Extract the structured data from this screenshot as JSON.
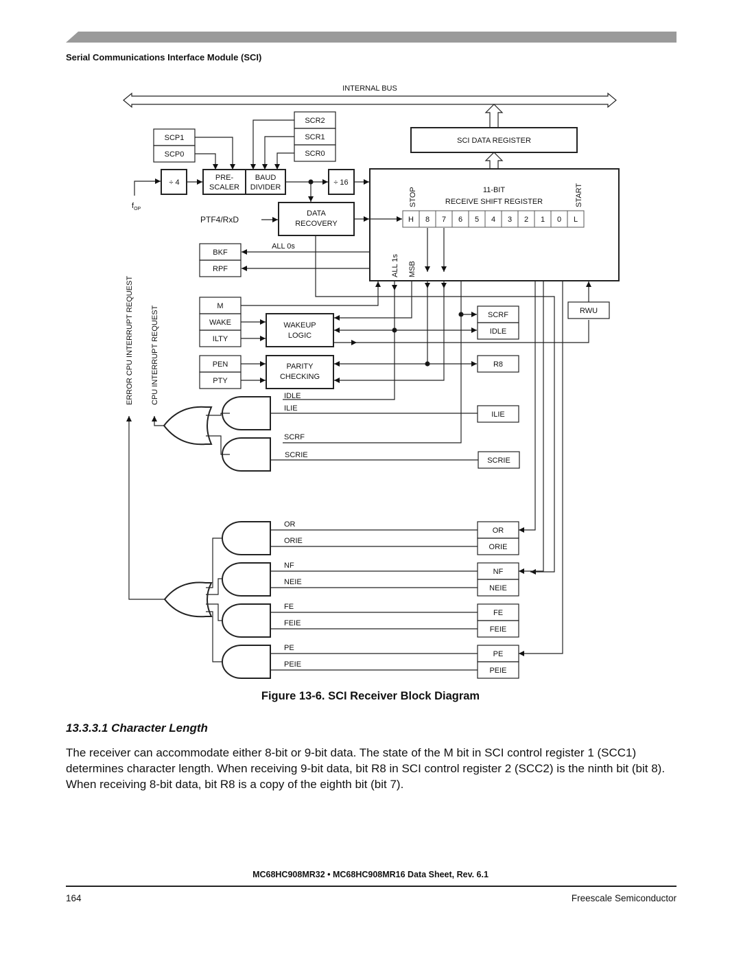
{
  "page": {
    "section_title": "Serial Communications Interface Module (SCI)",
    "figure_caption": "Figure 13-6. SCI Receiver Block Diagram",
    "subheading": "13.3.3.1  Character Length",
    "body": "The receiver can accommodate either 8-bit or 9-bit data. The state of the M bit in SCI control register 1 (SCC1) determines character length. When receiving 9-bit data, bit R8 in SCI control register 2 (SCC2) is the ninth bit (bit 8). When receiving 8-bit data, bit R8 is a copy of the eighth bit (bit 7).",
    "footer_title": "MC68HC908MR32 • MC68HC908MR16 Data Sheet, Rev. 6.1",
    "page_number": "164",
    "company": "Freescale Semiconductor",
    "header_bar_color": "#9a9a9a"
  },
  "diagram": {
    "internal_bus": "INTERNAL BUS",
    "sci_data_register": "SCI DATA REGISTER",
    "scp": [
      "SCP1",
      "SCP0"
    ],
    "scr": [
      "SCR2",
      "SCR1",
      "SCR0"
    ],
    "div4": "÷ 4",
    "div16": "÷ 16",
    "prescaler": [
      "PRE-",
      "SCALER"
    ],
    "baud_divider": [
      "BAUD",
      "DIVIDER"
    ],
    "fop": "f",
    "fop_sub": "OP",
    "rxd": "PTF4/RxD",
    "data_recovery": [
      "DATA",
      "RECOVERY"
    ],
    "all0s": "ALL 0s",
    "bkf": "BKF",
    "rpf": "RPF",
    "shift_register": {
      "title": [
        "11-BIT",
        "RECEIVE SHIFT REGISTER"
      ],
      "stop": "STOP",
      "start": "START",
      "bits": [
        "H",
        "8",
        "7",
        "6",
        "5",
        "4",
        "3",
        "2",
        "1",
        "0",
        "L"
      ],
      "all1s": "ALL 1s",
      "msb": "MSB"
    },
    "scc1_bits": [
      "M",
      "WAKE",
      "ILTY"
    ],
    "wakeup_logic": [
      "WAKEUP",
      "LOGIC"
    ],
    "parity_bits": [
      "PEN",
      "PTY"
    ],
    "parity_checking": [
      "PARITY",
      "CHECKING"
    ],
    "scrf_idle": [
      "SCRF",
      "IDLE"
    ],
    "r8": "R8",
    "rwu": "RWU",
    "ilie": "ILIE",
    "scrie": "SCRIE",
    "gate_labels": [
      "IDLE",
      "ILIE",
      "SCRF",
      "SCRIE",
      "OR",
      "ORIE",
      "NF",
      "NEIE",
      "FE",
      "FEIE",
      "PE",
      "PEIE"
    ],
    "error_regs": [
      [
        "OR",
        "ORIE"
      ],
      [
        "NF",
        "NEIE"
      ],
      [
        "FE",
        "FEIE"
      ],
      [
        "PE",
        "PEIE"
      ]
    ],
    "error_irq": "ERROR CPU INTERRUPT REQUEST",
    "cpu_irq": "CPU INTERRUPT REQUEST"
  }
}
